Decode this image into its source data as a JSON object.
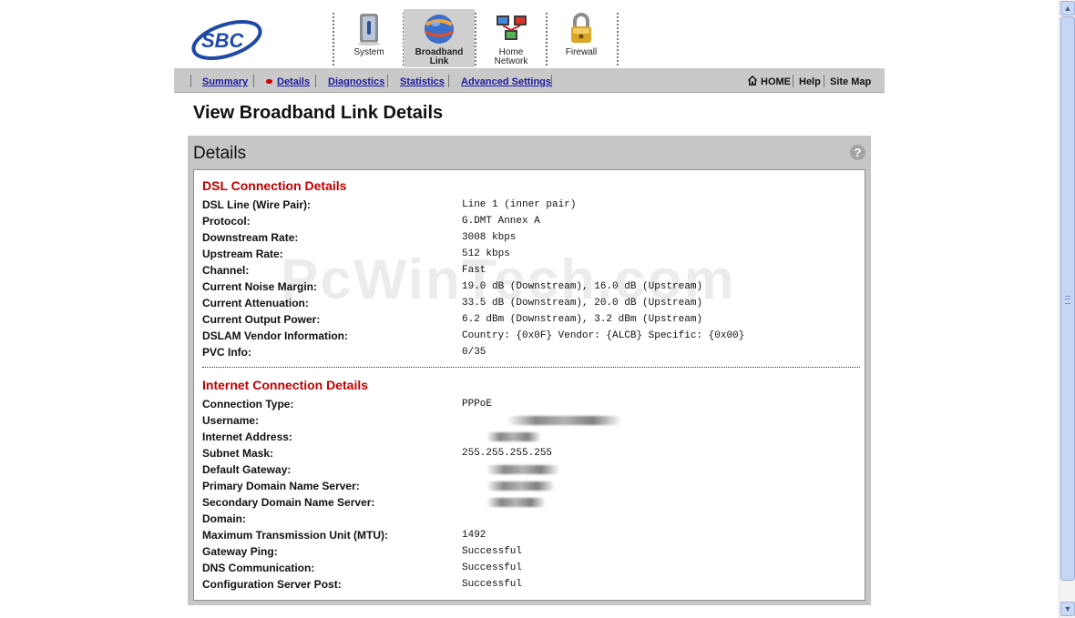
{
  "brand": {
    "logo_text": "SBC",
    "colors": {
      "logo": "#1f4aa8",
      "accent_red": "#c00000",
      "link_blue": "#1a1aa0"
    }
  },
  "nav": {
    "tabs": [
      {
        "label_line1": "System",
        "label_line2": "",
        "icon": "system-icon",
        "active": false
      },
      {
        "label_line1": "Broadband",
        "label_line2": "Link",
        "icon": "broadband-globe-icon",
        "active": true
      },
      {
        "label_line1": "Home",
        "label_line2": "Network",
        "icon": "home-network-icon",
        "active": false
      },
      {
        "label_line1": "Firewall",
        "label_line2": "",
        "icon": "firewall-lock-icon",
        "active": false
      }
    ]
  },
  "subnav": {
    "links": [
      "Summary",
      "Details",
      "Diagnostics",
      "Statistics",
      "Advanced Settings"
    ],
    "active": "Details",
    "utility": {
      "home": "HOME",
      "help": "Help",
      "sitemap": "Site Map"
    }
  },
  "page_title": "View Broadband Link Details",
  "panel": {
    "heading": "Details",
    "help_icon": "?"
  },
  "dsl": {
    "title": "DSL Connection Details",
    "rows": [
      {
        "label": "DSL Line (Wire Pair):",
        "value": "Line 1 (inner pair)"
      },
      {
        "label": "Protocol:",
        "value": "G.DMT Annex A"
      },
      {
        "label": "Downstream Rate:",
        "value": "3008 kbps"
      },
      {
        "label": "Upstream Rate:",
        "value": "512 kbps"
      },
      {
        "label": "Channel:",
        "value": "Fast"
      },
      {
        "label": "Current Noise Margin:",
        "value": "19.0 dB (Downstream), 16.0 dB (Upstream)"
      },
      {
        "label": "Current Attenuation:",
        "value": "33.5 dB (Downstream), 20.0 dB (Upstream)"
      },
      {
        "label": "Current Output Power:",
        "value": "6.2 dBm (Downstream), 3.2 dBm (Upstream)"
      },
      {
        "label": "DSLAM Vendor Information:",
        "value": "Country: {0x0F} Vendor: {ALCB} Specific: {0x00}"
      },
      {
        "label": "PVC Info:",
        "value": "0/35"
      }
    ]
  },
  "internet": {
    "title": "Internet Connection Details",
    "rows": [
      {
        "label": "Connection Type:",
        "value": "PPPoE"
      },
      {
        "label": "Username:",
        "value": ""
      },
      {
        "label": "Internet Address:",
        "value": ""
      },
      {
        "label": "Subnet Mask:",
        "value": "255.255.255.255"
      },
      {
        "label": "Default Gateway:",
        "value": ""
      },
      {
        "label": "Primary Domain Name Server:",
        "value": ""
      },
      {
        "label": "Secondary Domain Name Server:",
        "value": ""
      },
      {
        "label": "Domain:",
        "value": ""
      },
      {
        "label": "Maximum Transmission Unit (MTU):",
        "value": "1492"
      },
      {
        "label": "Gateway Ping:",
        "value": "Successful"
      },
      {
        "label": "DNS Communication:",
        "value": "Successful"
      },
      {
        "label": "Configuration Server Post:",
        "value": "Successful"
      }
    ]
  },
  "watermark": "PcWinTech.com"
}
